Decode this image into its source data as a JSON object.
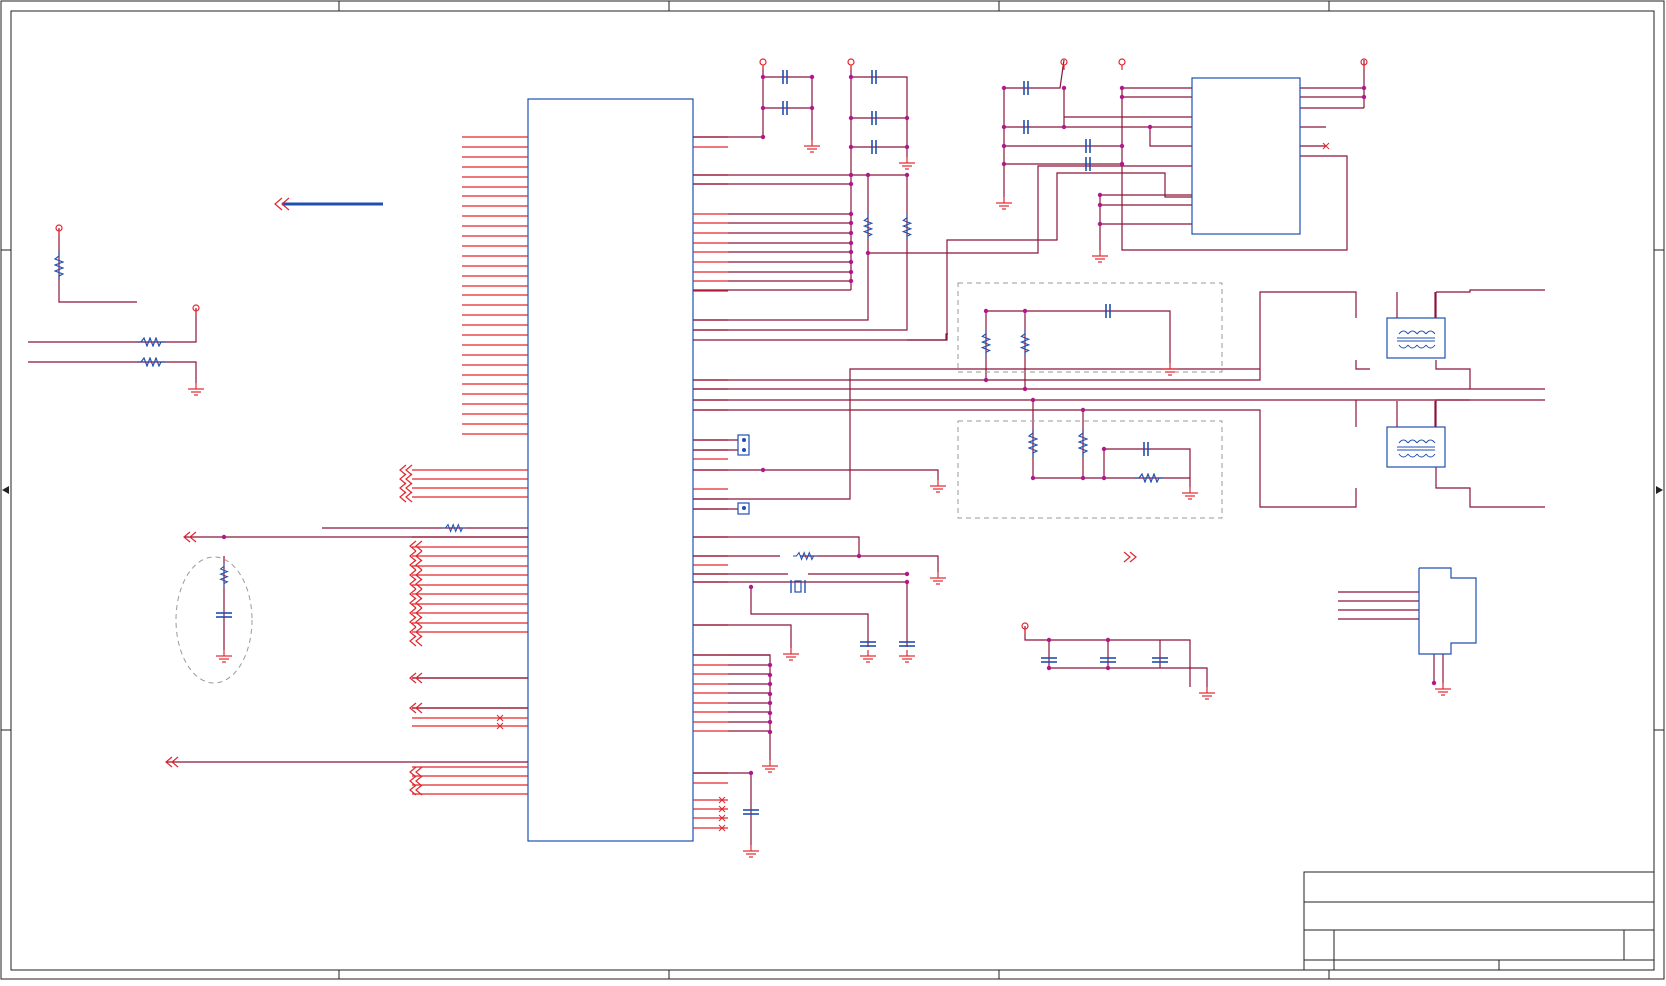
{
  "colors": {
    "frame": "#222222",
    "wire": "#8b1538",
    "pin": "#e3262d",
    "part": "#1f4fb0",
    "junction": "#b1178f",
    "dashed": "#9a9a9a"
  },
  "title_block": {
    "title": "",
    "document_number": "",
    "size": "",
    "revision": "",
    "date": "",
    "sheet": ""
  }
}
